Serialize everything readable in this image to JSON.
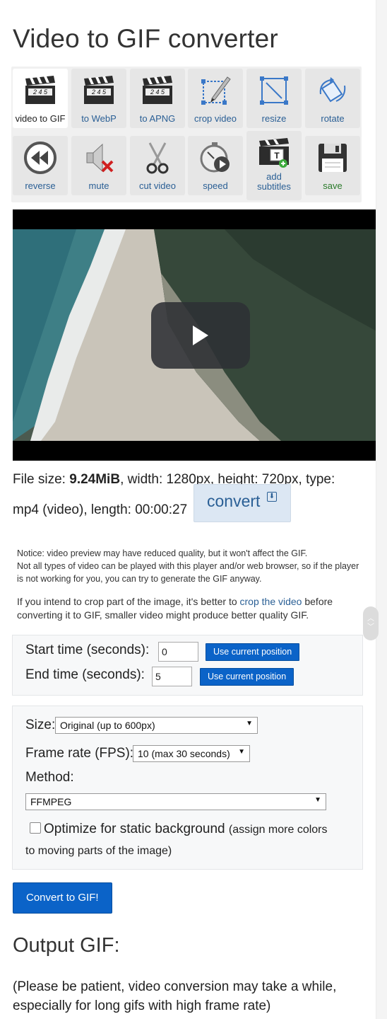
{
  "title": "Video to GIF converter",
  "tools": [
    {
      "label": "video to GIF",
      "icon": "clapperboard-icon",
      "active": true
    },
    {
      "label": "to WebP",
      "icon": "clapperboard-icon"
    },
    {
      "label": "to APNG",
      "icon": "clapperboard-icon"
    },
    {
      "label": "crop video",
      "icon": "crop-icon"
    },
    {
      "label": "resize",
      "icon": "resize-icon"
    },
    {
      "label": "rotate",
      "icon": "rotate-icon"
    },
    {
      "label": "reverse",
      "icon": "rewind-icon"
    },
    {
      "label": "mute",
      "icon": "mute-speaker-icon"
    },
    {
      "label": "cut video",
      "icon": "scissors-icon"
    },
    {
      "label": "speed",
      "icon": "stopwatch-icon"
    },
    {
      "label": "add subtitles",
      "icon": "subtitles-clapper-icon"
    },
    {
      "label": "save",
      "icon": "floppy-disk-icon"
    }
  ],
  "clapper_text": "2 4 5",
  "file": {
    "size_label": "File size: ",
    "size": "9.24MiB",
    "details": ", width: 1280px, height: 720px, type:",
    "details2": "mp4 (video), length: 00:00:27"
  },
  "convert_label": "convert",
  "notice_line1": "Notice: video preview may have reduced quality, but it won't affect the GIF.",
  "notice_line2": "Not all types of video can be played with this player and/or web browser, so if the player is not working for you, you can try to generate the GIF anyway.",
  "crop_note": {
    "before": "If you intend to crop part of the image, it's better to ",
    "link": "crop the video",
    "after": " before converting it to GIF, smaller video might produce better quality GIF."
  },
  "timing": {
    "start_label": "Start time (seconds):",
    "start_value": "0",
    "end_label": "End time (seconds):",
    "end_value": "5",
    "use_current": "Use current position"
  },
  "options": {
    "size_label": "Size:",
    "size_value": "Original (up to 600px)",
    "fps_label": "Frame rate (FPS):",
    "fps_value": "10 (max 30 seconds)",
    "method_label": "Method:",
    "method_value": "FFMPEG",
    "optimize_label": "Optimize for static background",
    "optimize_note": "(assign more colors",
    "optimize_note2": "to moving parts of the image)",
    "optimize_checked": false
  },
  "convert_gif_label": "Convert to GIF!",
  "output_title": "Output GIF:",
  "patience_note": "(Please be patient, video conversion may take a while, especially for long gifs with high frame rate)"
}
